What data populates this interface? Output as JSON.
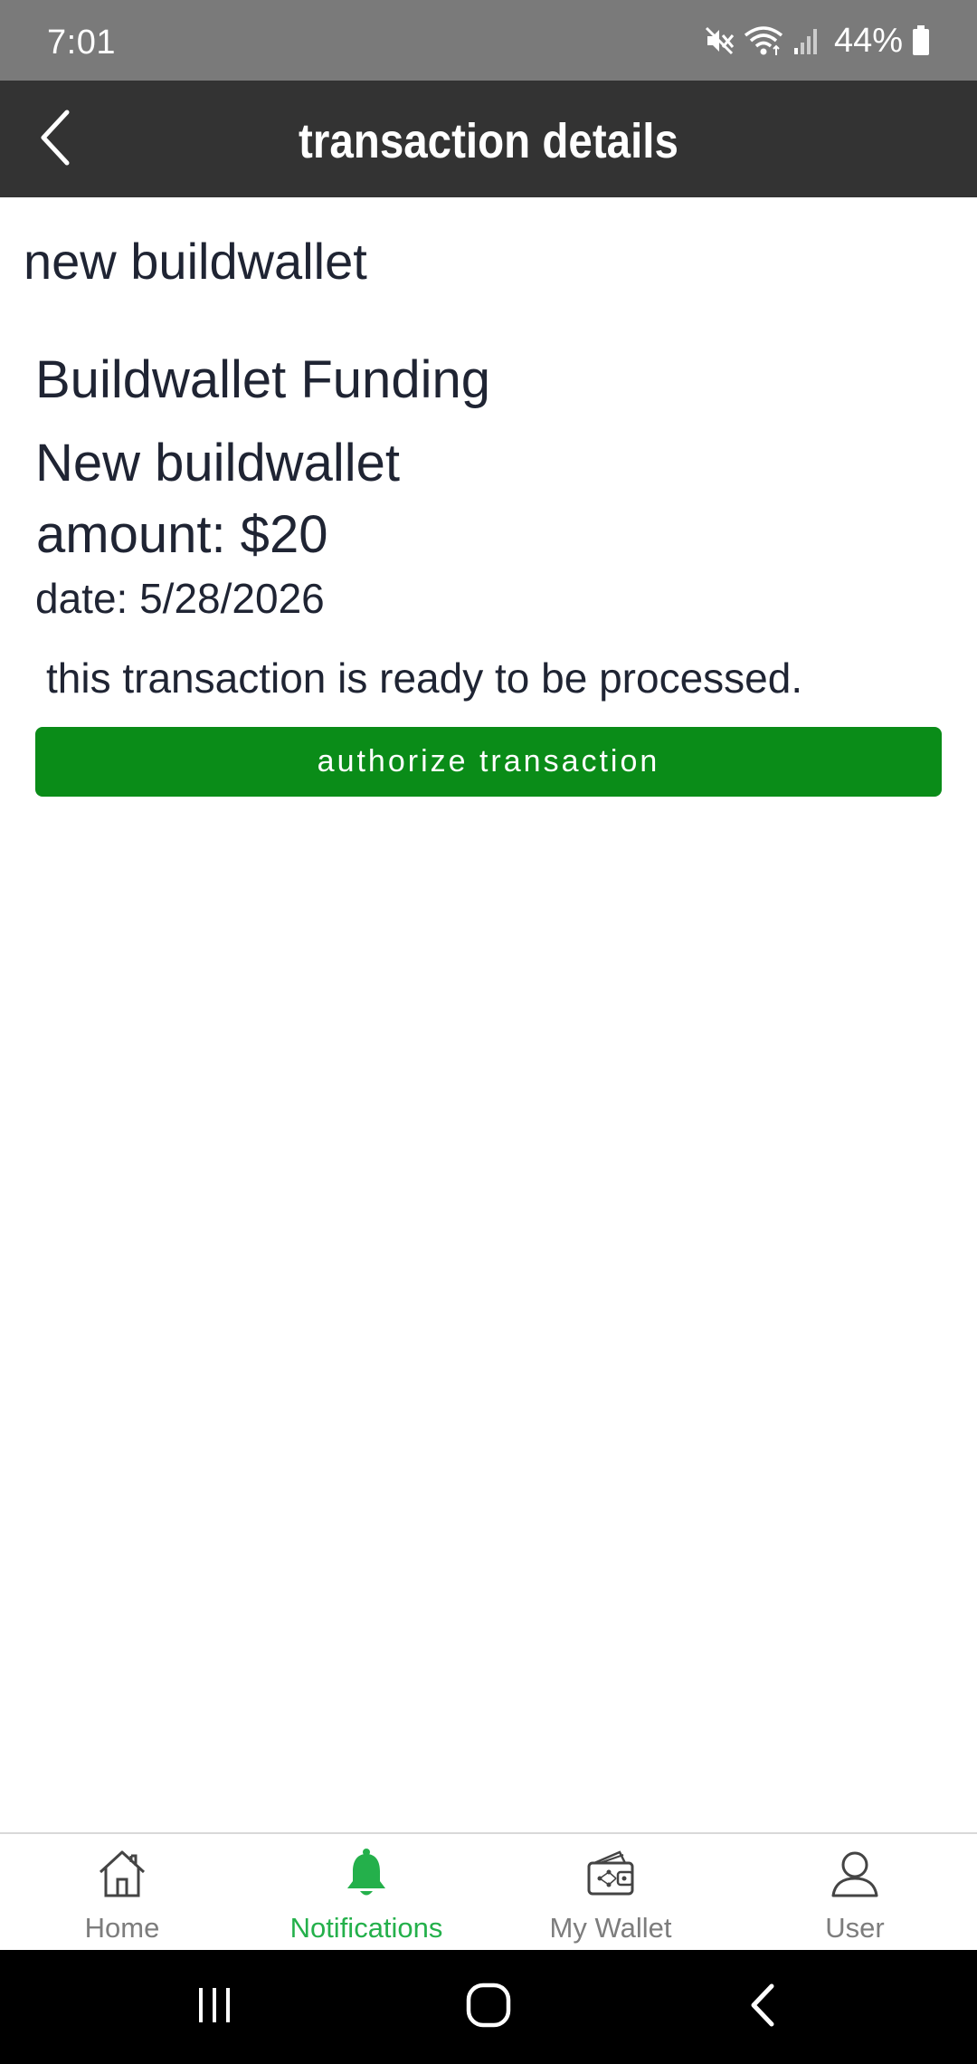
{
  "status_bar": {
    "time": "7:01",
    "battery_percent": "44%",
    "icons": [
      "mute-icon",
      "wifi-icon",
      "signal-icon",
      "battery-icon"
    ]
  },
  "header": {
    "title": "transaction details",
    "back_icon": "chevron-left-icon"
  },
  "content": {
    "section_title": "new buildwallet",
    "transaction_type": "Buildwallet Funding",
    "wallet_name": "New buildwallet",
    "amount": "amount: $20",
    "date": "date: 5/28/2026",
    "status_message": "this transaction is ready to be processed.",
    "authorize_label": "authorize transaction"
  },
  "bottom_nav": {
    "items": [
      {
        "label": "Home",
        "icon": "home-icon"
      },
      {
        "label": "Notifications",
        "icon": "bell-icon",
        "active": true
      },
      {
        "label": "My Wallet",
        "icon": "wallet-icon"
      },
      {
        "label": "User",
        "icon": "user-icon"
      }
    ]
  },
  "colors": {
    "status_bar": "#7a7a7a",
    "header": "#333333",
    "primary_button": "#0a8c18",
    "nav_active": "#24b04b",
    "nav_inactive": "#7d7d7d",
    "text": "#1f2433"
  }
}
